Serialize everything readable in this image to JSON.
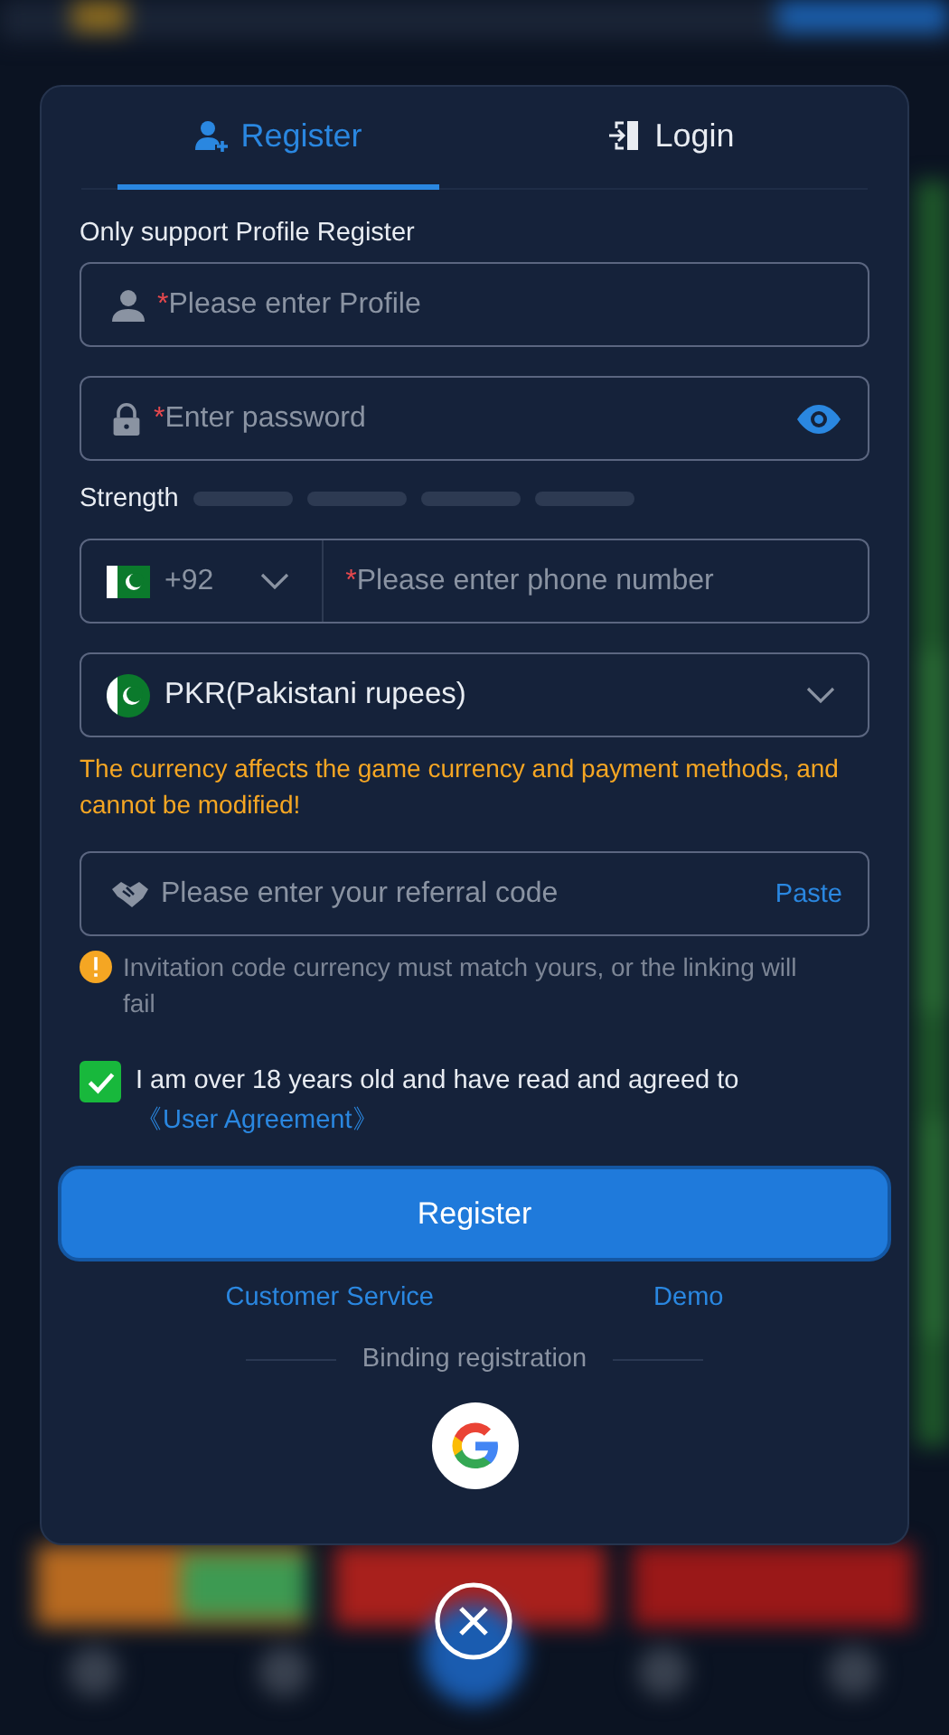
{
  "tabs": [
    {
      "label": "Register",
      "kind": "register",
      "selected": true
    },
    {
      "label": "Login",
      "kind": "login",
      "selected": false
    }
  ],
  "notice": "Only support Profile Register",
  "profile": {
    "marker": "*",
    "placeholder": "Please enter Profile"
  },
  "password": {
    "marker": "*",
    "placeholder": "Enter password"
  },
  "strength": {
    "label": "Strength"
  },
  "phone": {
    "code": "+92",
    "marker": "*",
    "placeholder": "Please enter phone number"
  },
  "currency": {
    "value": "PKR(Pakistani rupees)"
  },
  "currency_warning": "The currency affects the game currency and payment methods, and cannot be modified!",
  "referral": {
    "placeholder": "Please enter your referral code",
    "paste": "Paste"
  },
  "referral_note": "Invitation code currency must match yours, or the linking will fail",
  "agreement": {
    "checked": true,
    "text": "I am over 18 years old and have read and agreed to",
    "link": "《User Agreement》"
  },
  "register_button": "Register",
  "links": [
    "Customer Service",
    "Demo"
  ],
  "binding": "Binding registration"
}
